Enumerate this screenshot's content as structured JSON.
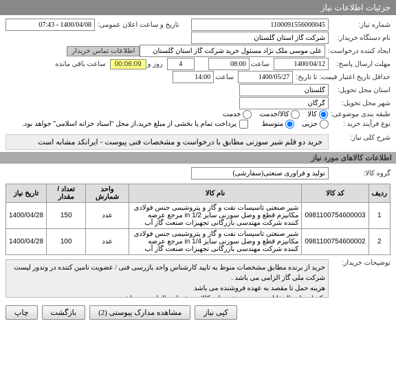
{
  "header": {
    "title": "جزئیات اطلاعات نیاز"
  },
  "f": {
    "need_no_label": "شماره نیاز:",
    "need_no": "1100091556000045",
    "pub_date_label": "تاریخ و ساعت اعلان عمومی:",
    "pub_date": "1400/04/08 - 07:43",
    "buyer_label": "نام دستگاه خریدار:",
    "buyer": "شرکت گاز استان گلستان",
    "creator_label": "ایجاد کننده درخواست:",
    "creator": "علی موسی ملک نژاد مسئول خرید شرکت گاز استان گلستان",
    "contact_btn": "اطلاعات تماس خریدار",
    "deadline_label": "مهلت ارسال پاسخ:",
    "deadline_date": "1400/04/12",
    "time_label": "ساعت",
    "deadline_time": "08:00",
    "remain_days": "4",
    "days_and": "روز و",
    "remain_hms": "00:06:09",
    "remain_suffix": "ساعت باقی مانده",
    "validity_label": "حداقل تاریخ اعتبار قیمت: تا تاریخ:",
    "validity_date": "1400/05/27",
    "validity_time": "14:00",
    "delivery_state_label": "استان محل تحویل:",
    "delivery_state": "گلستان",
    "delivery_city_label": "شهر محل تحویل:",
    "delivery_city": "گرگان",
    "budget_label": "طبقه بندی موضوعی:",
    "r_goods": "کالا",
    "r_service": "کالا/خدمت",
    "r_serv": "خدمت",
    "process_label": "نوع فرآیند خرید :",
    "r_small": "جزیی",
    "r_medium": "متوسط",
    "pay_note": "پرداخت تمام یا بخشی از مبلغ خرید،از محل \"اسناد خزانه اسلامی\" خواهد بود.",
    "main_desc_label": "شرح کلی نیاز:",
    "main_desc": "خرید دو قلم شیر سوزنی مطابق با درخواست و مشخصات فنی پیوست - ایرانکد مشابه است"
  },
  "goods": {
    "section": "اطلاعات کالاهای مورد نیاز",
    "group_label": "گروه کالا:",
    "group": "تولید و فرآوری صنعتی(سفارشی)",
    "cols": {
      "row": "ردیف",
      "code": "کد کالا",
      "name": "نام کالا",
      "unit": "واحد شمارش",
      "qty": "تعداد / مقدار",
      "date": "تاریخ نیاز"
    },
    "rows": [
      {
        "n": "1",
        "code": "0981100754600003",
        "name": "شیر صنعتی تاسیسات نفت و گاز و پتروشیمی جنس فولادی مکانیزم قطع و وصل سوزنی سایز 1/2 in مرجع عرضه کننده شرکت مهندسی بازرگانی تجهیزات صنعت گاز آب",
        "unit": "عدد",
        "qty": "150",
        "date": "1400/04/28"
      },
      {
        "n": "2",
        "code": "0981100754600002",
        "name": "شیر صنعتی تاسیسات نفت و گاز و پتروشیمی جنس فولادی مکانیزم قطع و وصل سوزنی سایز 1/4 in مرجع عرضه کننده شرکت مهندسی بازرگانی تجهیزات صنعت گاز آب",
        "unit": "عدد",
        "qty": "100",
        "date": "1400/04/28"
      }
    ]
  },
  "notes": {
    "label": "توضیحات خریدار:",
    "lines": [
      "خرید از برنده مطابق مشخصات منوط به تایید کارشناس واحد بازرسی فنی / عضویت تامین کننده در وندور لیست شرکت ملی گاز الزامی می باشد .",
      "هزینه حمل تا مقصد به عهده فروشنده می باشد",
      "تکمیل و ارسال فایل پیوست و مشخصات کالای پیشنهادی الزامی می باشد"
    ]
  },
  "footer": {
    "print": "چاپ",
    "back": "بازگشت",
    "attach": "مشاهده مدارک پیوستی (2)",
    "copy": "کپی نیاز"
  }
}
